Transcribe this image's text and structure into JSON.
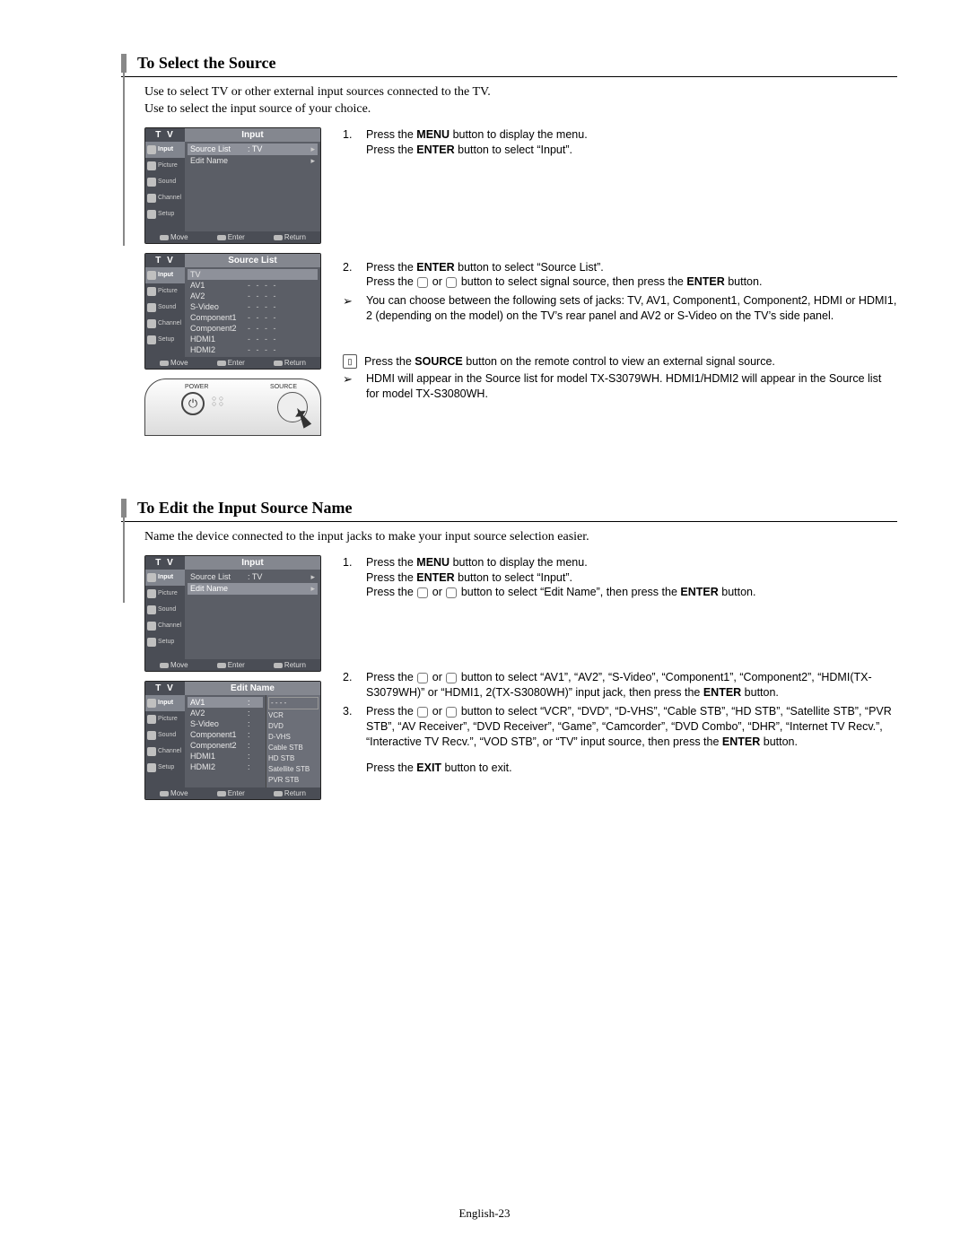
{
  "section1": {
    "title": "To Select the Source",
    "intro1": "Use to select TV or other external input sources connected to the TV.",
    "intro2": "Use to select the input source of your choice.",
    "osd_input": {
      "tv": "T V",
      "title": "Input",
      "tabs": [
        "Input",
        "Picture",
        "Sound",
        "Channel",
        "Setup"
      ],
      "rows": [
        {
          "label": "Source List",
          "value": ": TV",
          "sel": true
        },
        {
          "label": "Edit Name",
          "value": "",
          "sel": false
        }
      ],
      "footer": [
        "Move",
        "Enter",
        "Return"
      ]
    },
    "osd_sourcelist": {
      "tv": "T V",
      "title": "Source List",
      "tabs": [
        "Input",
        "Picture",
        "Sound",
        "Channel",
        "Setup"
      ],
      "items": [
        "TV",
        "AV1",
        "AV2",
        "S-Video",
        "Component1",
        "Component2",
        "HDMI1",
        "HDMI2"
      ],
      "footer": [
        "Move",
        "Enter",
        "Return"
      ]
    },
    "remote": {
      "power": "POWER",
      "source": "SOURCE"
    },
    "steps": {
      "s1_a": "Press the ",
      "s1_b": "MENU",
      "s1_c": " button to display the menu.",
      "s1_d": "Press the ",
      "s1_e": "ENTER",
      "s1_f": " button to select “Input”.",
      "s2_a": "Press the ",
      "s2_b": "ENTER",
      "s2_c": " button to select “Source List”.",
      "s2_d": "Press the ",
      "s2_e": " or ",
      "s2_f": " button to select signal source, then press the ",
      "s2_g": "ENTER",
      "s2_h": " button.",
      "s2_bullet": "You can choose between the following sets of jacks: TV, AV1, Component1, Component2, HDMI or HDMI1, 2 (depending on the model) on the TV’s rear panel and AV2 or S-Video on the TV’s side panel.",
      "note_a": "Press the ",
      "note_b": "SOURCE",
      "note_c": " button on the remote control to view an external signal source.",
      "note2": "HDMI will appear in the Source list for model TX-S3079WH. HDMI1/HDMI2 will appear in the Source list for model TX-S3080WH."
    }
  },
  "section2": {
    "title": "To Edit the Input Source Name",
    "intro": "Name the device connected to the input jacks to make your input source selection easier.",
    "osd_input": {
      "tv": "T V",
      "title": "Input",
      "tabs": [
        "Input",
        "Picture",
        "Sound",
        "Channel",
        "Setup"
      ],
      "rows": [
        {
          "label": "Source List",
          "value": ": TV",
          "sel": false
        },
        {
          "label": "Edit Name",
          "value": "",
          "sel": true
        }
      ],
      "footer": [
        "Move",
        "Enter",
        "Return"
      ]
    },
    "osd_editname": {
      "tv": "T V",
      "title": "Edit Name",
      "tabs": [
        "Input",
        "Picture",
        "Sound",
        "Channel",
        "Setup"
      ],
      "items": [
        "AV1",
        "AV2",
        "S-Video",
        "Component1",
        "Component2",
        "HDMI1",
        "HDMI2"
      ],
      "values": [
        "- - - -",
        "VCR",
        "DVD",
        "D-VHS",
        "Cable STB",
        "HD STB",
        "Satellite STB",
        "PVR STB"
      ],
      "footer": [
        "Move",
        "Enter",
        "Return"
      ]
    },
    "steps": {
      "s1_a": "Press the ",
      "s1_b": "MENU",
      "s1_c": " button to display the menu.",
      "s1_d": "Press the ",
      "s1_e": "ENTER",
      "s1_f": " button to select “Input”.",
      "s1_g": "Press the ",
      "s1_h": " or ",
      "s1_i": " button to select “Edit Name”, then press the ",
      "s1_j": "ENTER",
      "s1_k": " button.",
      "s2_a": "Press the ",
      "s2_b": " or ",
      "s2_c": " button to select “AV1”, “AV2”, “S-Video”, “Component1”, “Component2”, “HDMI(TX-S3079WH)” or “HDMI1, 2(TX-S3080WH)” input jack, then press the ",
      "s2_d": "ENTER",
      "s2_e": " button.",
      "s3_a": "Press the ",
      "s3_b": " or ",
      "s3_c": " button to select “VCR”, “DVD”, “D-VHS”, “Cable STB”, “HD STB”, “Satellite STB”, “PVR STB”, “AV Receiver”, “DVD Receiver”, “Game”, “Camcorder”, “DVD Combo”, “DHR”, “Internet TV Recv.”, “Interactive TV Recv.”, “VOD STB”, or “TV” input source, then press the ",
      "s3_d": "ENTER",
      "s3_e": " button.",
      "exit_a": "Press the ",
      "exit_b": "EXIT",
      "exit_c": " button to exit."
    }
  },
  "nums": {
    "n1": "1.",
    "n2": "2.",
    "n3": "3."
  },
  "arrow": "➢",
  "page_num": "English-23"
}
